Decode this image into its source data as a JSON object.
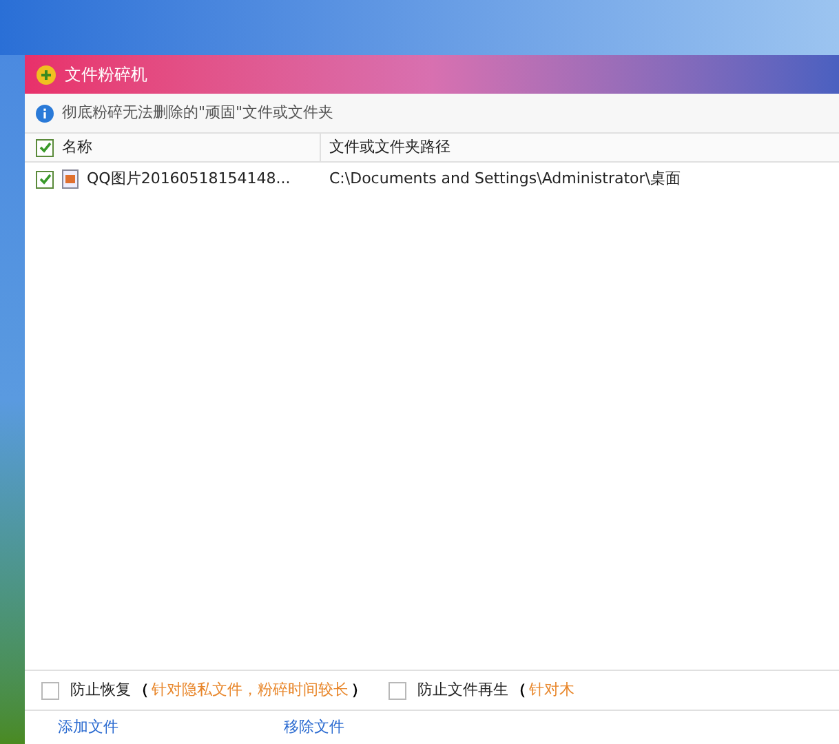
{
  "window": {
    "title": "文件粉碎机"
  },
  "info": "彻底粉碎无法删除的\"顽固\"文件或文件夹",
  "table": {
    "header_checked": true,
    "columns": [
      "名称",
      "文件或文件夹路径"
    ],
    "rows": [
      {
        "checked": true,
        "name": "QQ图片20160518154148...",
        "path": "C:\\Documents and Settings\\Administrator\\桌面"
      }
    ]
  },
  "options": [
    {
      "checked": false,
      "label": "防止恢复",
      "open": "（",
      "note": "针对隐私文件，粉碎时间较长",
      "close": "）"
    },
    {
      "checked": false,
      "label": "防止文件再生",
      "open": "（",
      "note": "针对木"
    }
  ],
  "links": [
    "添加文件",
    "移除文件"
  ]
}
